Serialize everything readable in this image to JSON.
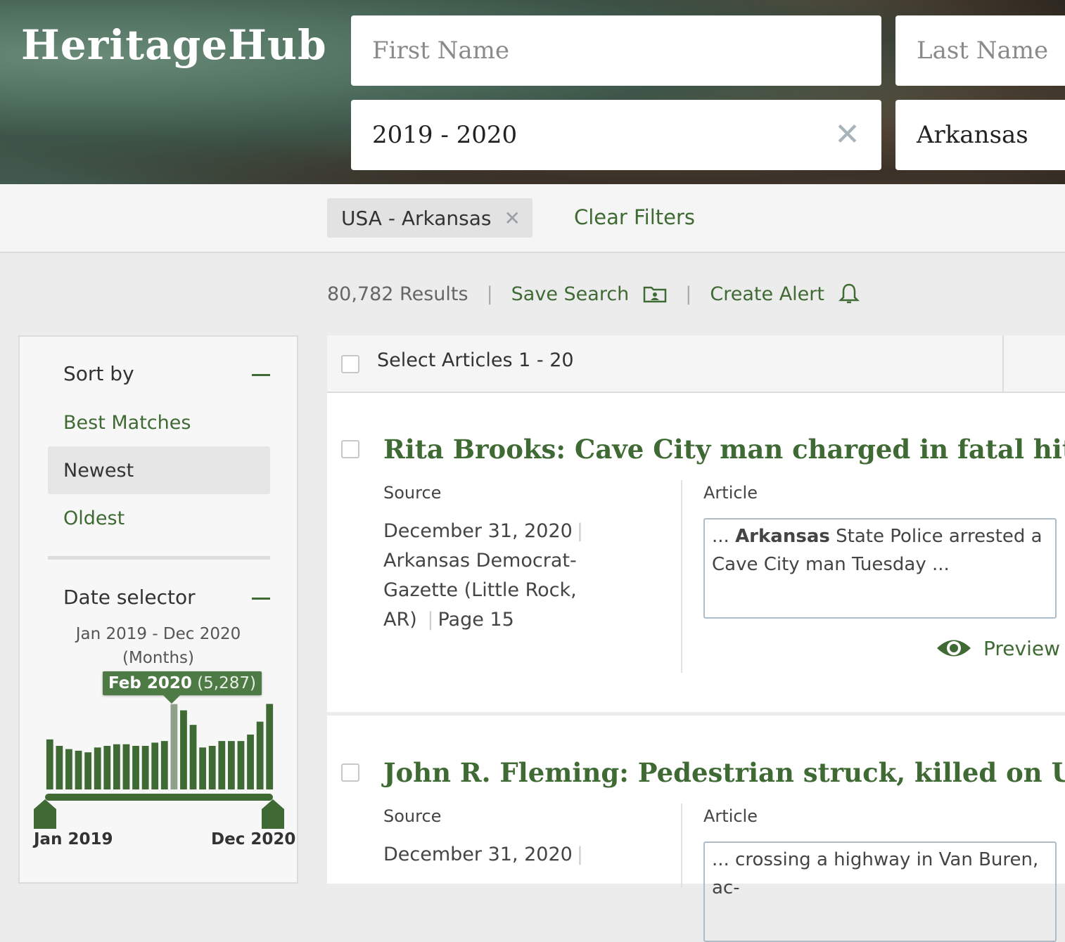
{
  "header": {
    "logo": "HeritageHub",
    "first_name_placeholder": "First Name",
    "last_name_placeholder": "Last Name",
    "date_value": "2019 - 2020",
    "location_value": "Arkansas"
  },
  "filters": {
    "chip_label": "USA - Arkansas",
    "clear_label": "Clear Filters"
  },
  "results": {
    "count": "80,782 Results",
    "save_search": "Save Search",
    "create_alert": "Create Alert"
  },
  "sidebar": {
    "sort_title": "Sort by",
    "sort_options": [
      "Best Matches",
      "Newest",
      "Oldest"
    ],
    "sort_selected": "Newest",
    "date_title": "Date selector",
    "date_range_line1": "Jan 2019 - Dec 2020",
    "date_range_line2": "(Months)",
    "tooltip_month": "Feb 2020",
    "tooltip_count": "(5,287)",
    "range_start": "Jan 2019",
    "range_end": "Dec 2020"
  },
  "chart_data": {
    "type": "bar",
    "title": "",
    "categories": [
      "Jan 2019",
      "Feb 2019",
      "Mar 2019",
      "Apr 2019",
      "May 2019",
      "Jun 2019",
      "Jul 2019",
      "Aug 2019",
      "Sep 2019",
      "Oct 2019",
      "Nov 2019",
      "Dec 2019",
      "Jan 2020",
      "Feb 2020",
      "Mar 2020",
      "Apr 2020",
      "May 2020",
      "Jun 2020",
      "Jul 2020",
      "Aug 2020",
      "Sep 2020",
      "Oct 2020",
      "Nov 2020",
      "Dec 2020"
    ],
    "values": [
      3100,
      2700,
      2500,
      2400,
      2300,
      2600,
      2700,
      2800,
      2800,
      2700,
      2700,
      2900,
      3000,
      5287,
      4900,
      4000,
      2600,
      2700,
      3000,
      3000,
      3000,
      3400,
      4200,
      5300
    ],
    "highlighted": "Feb 2020",
    "ylim": [
      0,
      5400
    ],
    "colors": {
      "bar": "#3f6a34",
      "highlight": "#8fa18a"
    }
  },
  "list": {
    "select_label": "Select Articles 1 - 20",
    "source_label": "Source",
    "article_label": "Article",
    "preview_label": "Preview",
    "articles": [
      {
        "title": "Rita Brooks: Cave City man charged in fatal hit-r",
        "date": "December 31, 2020",
        "publication": "Arkansas Democrat-Gazette (Little Rock, AR)",
        "page": "Page 15",
        "snippet_prefix": "... ",
        "snippet_bold": "Arkansas",
        "snippet_rest": " State Police arrested a Cave City man Tuesday ..."
      },
      {
        "title": "John R. Fleming: Pedestrian struck, killed on U.S",
        "date": "December 31, 2020",
        "snippet": "... crossing a highway in Van Buren, ac-"
      }
    ]
  },
  "colors": {
    "accent": "#3f6a34",
    "text": "#333333",
    "muted": "#666666"
  }
}
